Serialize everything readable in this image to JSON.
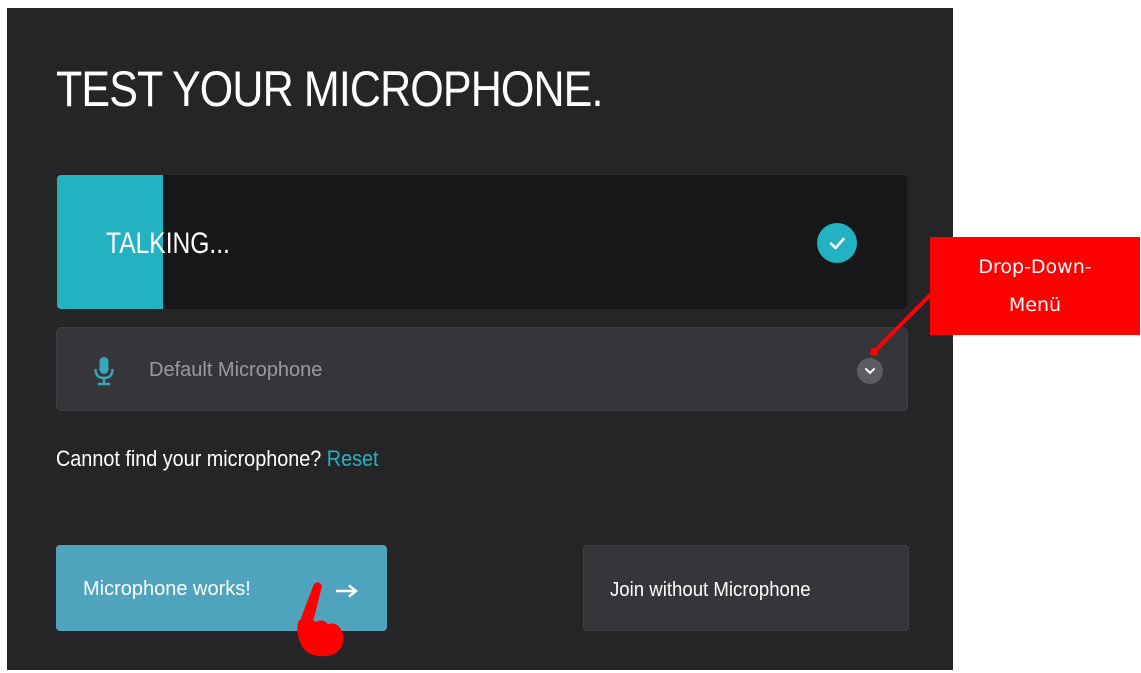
{
  "title": "TEST YOUR MICROPHONE.",
  "level": {
    "status_text": "TALKING...",
    "fill_fraction": 0.125,
    "check_icon": "check-circle-icon",
    "accent": "#22b2c1"
  },
  "dropdown": {
    "icon": "microphone-icon",
    "selected": "Default Microphone",
    "chevron_icon": "chevron-down-icon"
  },
  "hint": {
    "text": "Cannot find your microphone?",
    "link": "Reset"
  },
  "buttons": {
    "primary_label": "Microphone works!",
    "primary_icon": "arrow-right-icon",
    "secondary_label": "Join without Microphone"
  },
  "annotation": {
    "line1": "Drop-Down-",
    "line2": "Menü",
    "color": "#ff0000"
  }
}
